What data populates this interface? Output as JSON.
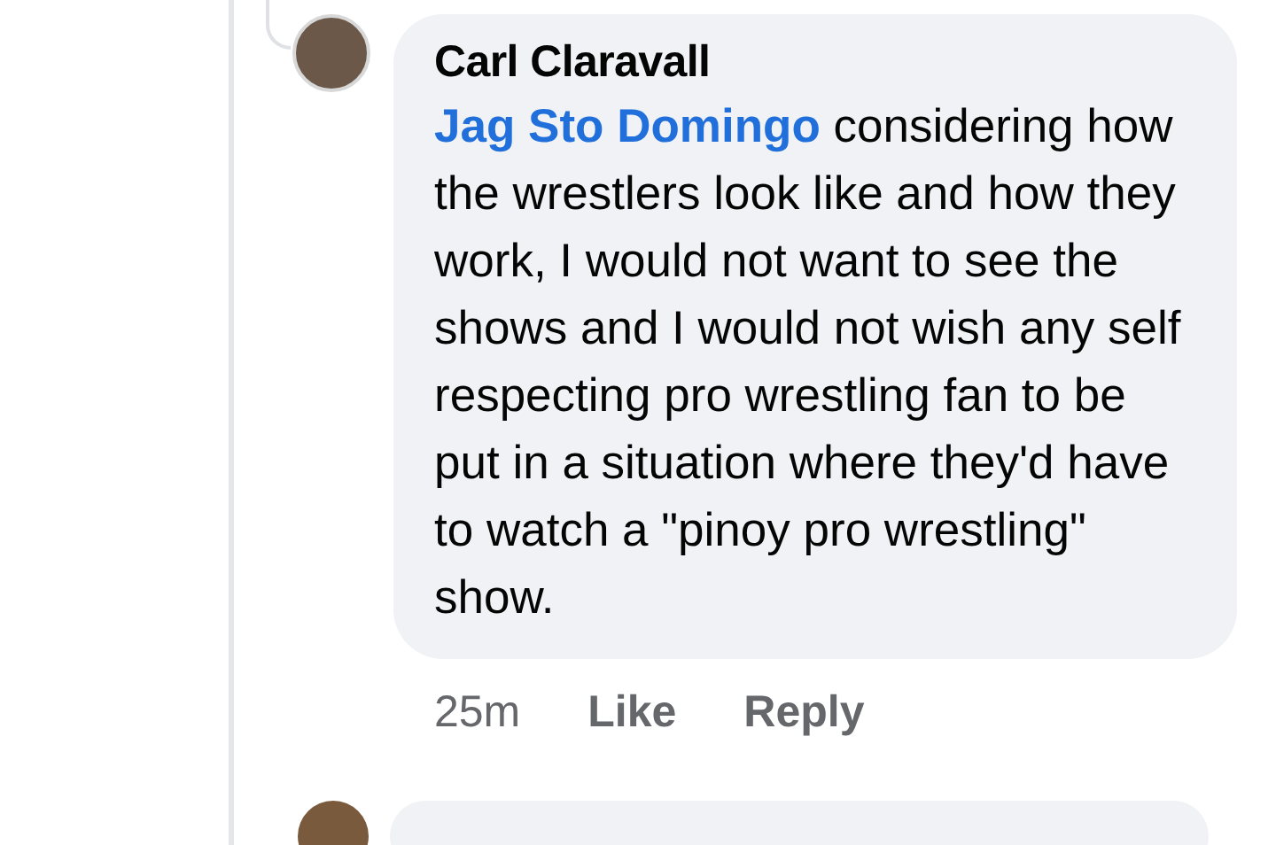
{
  "comment": {
    "author": "Carl Claravall",
    "mention": "Jag Sto Domingo",
    "text": "considering how the wrestlers look like and how they work, I would not want to see the shows and I would not wish any self respecting pro wrestling fan to be put in a situation where they'd have to watch a \"pinoy pro wrestling\" show.",
    "time": "25m",
    "actions": [
      "Like",
      "Reply"
    ]
  }
}
